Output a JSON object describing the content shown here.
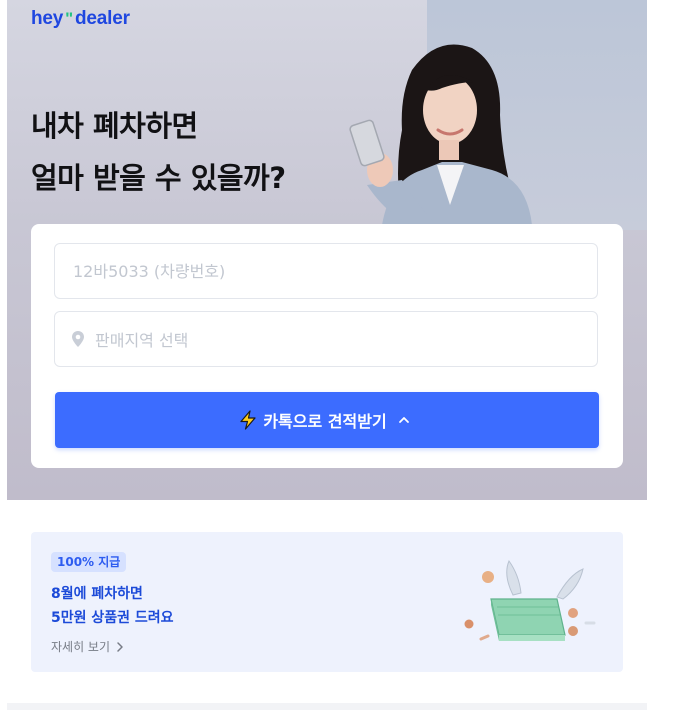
{
  "brand": {
    "logo_left": "hey",
    "logo_mark": "\"",
    "logo_right": "dealer"
  },
  "hero": {
    "headline_line1": "내차 폐차하면",
    "headline_line2": "얼마 받을 수 있을까?"
  },
  "form": {
    "plate_placeholder": "12바5033 (차량번호)",
    "region_placeholder": "판매지역 선택",
    "cta_label": "카톡으로 견적받기"
  },
  "promo": {
    "badge": "100% 지급",
    "title_line1": "8월에 폐차하면",
    "title_line2": "5만원 상품권 드려요",
    "link_label": "자세히 보기"
  },
  "icons": {
    "region": "location-pin-icon",
    "cta_left": "lightning-icon",
    "cta_right": "chevron-up-icon",
    "link": "chevron-right-icon"
  },
  "colors": {
    "brand_blue": "#1f47e0",
    "brand_green": "#22c283",
    "cta_blue": "#3c6cff",
    "promo_bg": "#eef2fd",
    "promo_text": "#1c4ad8"
  }
}
